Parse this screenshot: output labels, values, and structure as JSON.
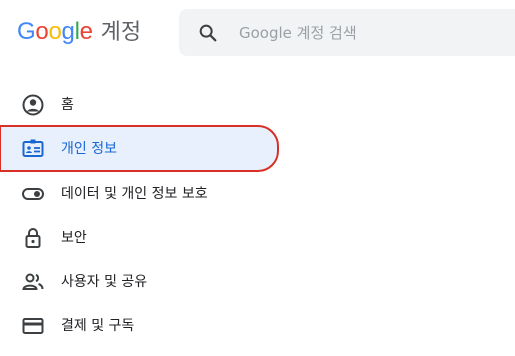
{
  "header": {
    "logo_letters": [
      "G",
      "o",
      "o",
      "g",
      "l",
      "e"
    ],
    "logo_colors": [
      "#4285F4",
      "#EA4335",
      "#FBBC05",
      "#4285F4",
      "#34A853",
      "#EA4335"
    ],
    "product": "계정"
  },
  "search": {
    "placeholder": "Google 계정 검색",
    "value": "",
    "icon": "search-icon"
  },
  "nav": {
    "items": [
      {
        "label": "홈",
        "icon": "account-circle-icon",
        "active": false
      },
      {
        "label": "개인 정보",
        "icon": "id-card-icon",
        "active": true
      },
      {
        "label": "데이터 및 개인 정보 보호",
        "icon": "toggle-icon",
        "active": false
      },
      {
        "label": "보안",
        "icon": "lock-icon",
        "active": false
      },
      {
        "label": "사용자 및 공유",
        "icon": "people-icon",
        "active": false
      },
      {
        "label": "결제 및 구독",
        "icon": "credit-card-icon",
        "active": false
      }
    ]
  },
  "colors": {
    "active_bg": "#e8f0fe",
    "active_text": "#1967d2",
    "highlight_border": "#d93025",
    "icon_gray": "#5f6368"
  }
}
